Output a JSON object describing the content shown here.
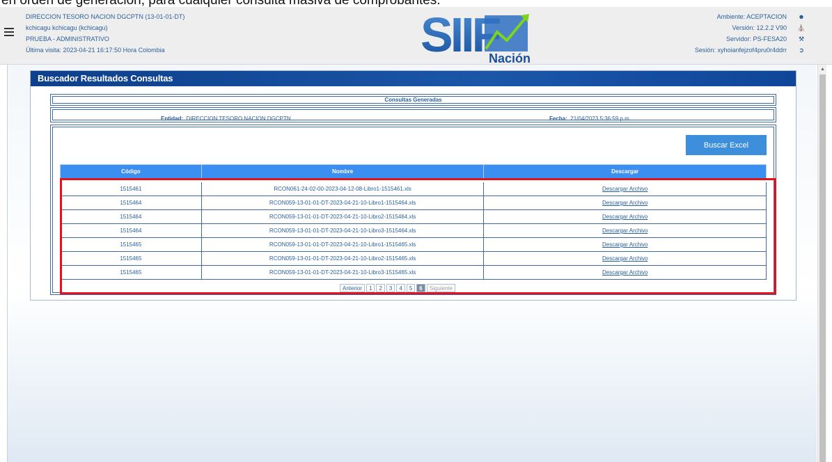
{
  "caption": "en orden de generación, para cualquier consulta masiva de comprobantes.",
  "header": {
    "entity": "DIRECCION TESORO NACION DGCPTN (13-01-01-DT)",
    "user": "kchicagu kchicagu (kchicagu)",
    "role": "PRUEBA - ADMINISTRATIVO",
    "last_visit": "Última visita: 2023-04-21 16:17:50 Hora Colombia",
    "environment": "Ambiente: ACEPTACION",
    "version": "Versión: 12.2.2 V90",
    "server": "Servidor: PS-FESA20",
    "session": "Sesión: xyhoianfejzof4pru0r4ddrr",
    "logo_main": "SIIF",
    "logo_sub": "Nación"
  },
  "panel": {
    "title": "Buscador Resultados Consultas",
    "generated_title": "Consultas Generadas",
    "entity_label": "Entidad:",
    "entity_value": "DIRECCION TESORO NACION DGCPTN",
    "date_label": "Fecha:",
    "date_value": "21/04/2023 5:36:59 p.m.",
    "excel_button": "Buscar Excel"
  },
  "table": {
    "headers": [
      "Código",
      "Nombre",
      "Descargar"
    ],
    "rows": [
      {
        "code": "1515461",
        "name": "RCON061-24-02-00-2023-04-12-08-Libro1-1515461.xls",
        "link": "Descargar Archivo"
      },
      {
        "code": "1515464",
        "name": "RCON059-13-01-01-DT-2023-04-21-10-Libro1-1515464.xls",
        "link": "Descargar Archivo"
      },
      {
        "code": "1515464",
        "name": "RCON059-13-01-01-DT-2023-04-21-10-Libro2-1515464.xls",
        "link": "Descargar Archivo"
      },
      {
        "code": "1515464",
        "name": "RCON059-13-01-01-DT-2023-04-21-10-Libro3-1515464.xls",
        "link": "Descargar Archivo"
      },
      {
        "code": "1515465",
        "name": "RCON059-13-01-01-DT-2023-04-21-10-Libro1-1515465.xls",
        "link": "Descargar Archivo"
      },
      {
        "code": "1515465",
        "name": "RCON059-13-01-01-DT-2023-04-21-10-Libro2-1515465.xls",
        "link": "Descargar Archivo"
      },
      {
        "code": "1515465",
        "name": "RCON059-13-01-01-DT-2023-04-21-10-Libro3-1515465.xls",
        "link": "Descargar Archivo"
      }
    ]
  },
  "pager": {
    "prev": "Anterior",
    "pages": [
      "1",
      "2",
      "3",
      "4",
      "5",
      "6"
    ],
    "current": "6",
    "next": "Siguiente"
  },
  "colors": {
    "header_bg": "#eeeeee",
    "text_blue": "#2b5f9a",
    "panel_title_bg": "#1b56a8",
    "table_header_bg": "#3a8ff0",
    "excel_button_bg": "#3d8fdc",
    "highlight_red": "#e3121b"
  }
}
